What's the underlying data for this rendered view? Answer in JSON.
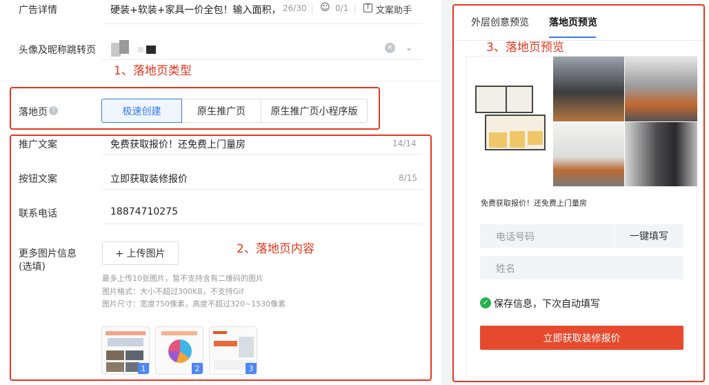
{
  "form": {
    "ad_detail": {
      "label": "广告详情",
      "value": "硬装+软装+家具一价全包！输入面积，",
      "count": "26/30",
      "emoji_count": "0/1",
      "assist": "文案助手"
    },
    "avatar": {
      "label": "头像及昵称跳转页"
    },
    "annotation1": "1、落地页类型",
    "landing": {
      "label": "落地页",
      "options": [
        "极速创建",
        "原生推广页",
        "原生推广页小程序版"
      ]
    },
    "promo": {
      "label": "推广文案",
      "value": "免费获取报价！还免费上门量房",
      "count": "14/14"
    },
    "button": {
      "label": "按钮文案",
      "value": "立即获取装修报价",
      "count": "8/15"
    },
    "phone": {
      "label": "联系电话",
      "value": "18874710275"
    },
    "images": {
      "label": "更多图片信息",
      "label2": "(选填)",
      "upload": "+ 上传图片",
      "hints": [
        "最多上传10张图片，暂不支持含有二维码的图片",
        "图片格式：大小不超过300KB，不支持Gif",
        "图片尺寸：宽度750像素，高度不超过320~1530像素"
      ],
      "badges": [
        "1",
        "2",
        "3"
      ]
    },
    "annotation2": "2、落地页内容"
  },
  "preview": {
    "tabs": [
      "外层创意预览",
      "落地页预览"
    ],
    "annotation3": "3、落地页预览",
    "promo_text": "免费获取报价！还免费上门量房",
    "phone_placeholder": "电话号码",
    "autofill": "一键填写",
    "name_placeholder": "姓名",
    "save_info": "保存信息，下次自动填写",
    "submit": "立即获取装修报价"
  },
  "colors": {
    "accent": "#3478f6",
    "annotation": "#e8341c",
    "submit": "#e64a2e",
    "check": "#22b14c"
  }
}
